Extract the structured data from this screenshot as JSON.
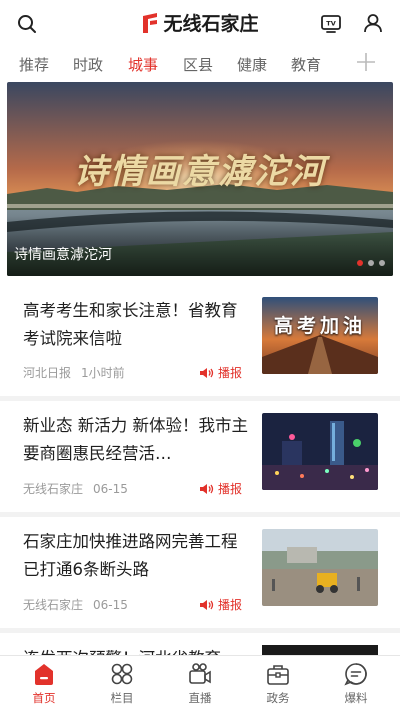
{
  "header": {
    "app_title": "无线石家庄",
    "brand_color": "#e2322b"
  },
  "tabs": [
    {
      "label": "推荐"
    },
    {
      "label": "时政"
    },
    {
      "label": "城事",
      "active": true
    },
    {
      "label": "区县"
    },
    {
      "label": "健康"
    },
    {
      "label": "教育"
    }
  ],
  "banner": {
    "overlay_title": "诗情画意滹沱河",
    "caption": "诗情画意滹沱河",
    "dot_count": 3,
    "active_dot": 1
  },
  "news": [
    {
      "title": "高考考生和家长注意！省教育考试院来信啦",
      "source": "河北日报",
      "time": "1小时前",
      "action": "播报",
      "thumb_text": "高考加油"
    },
    {
      "title": "新业态 新活力 新体验！我市主要商圈惠民经营活…",
      "source": "无线石家庄",
      "time": "06-15",
      "action": "播报"
    },
    {
      "title": "石家庄加快推进路网完善工程 已打通6条断头路",
      "source": "无线石家庄",
      "time": "06-15",
      "action": "播报"
    },
    {
      "title": "连发两次预警！河北省教育"
    }
  ],
  "bottom_nav": [
    {
      "label": "首页",
      "icon": "home-icon",
      "active": true
    },
    {
      "label": "栏目",
      "icon": "grid-icon"
    },
    {
      "label": "直播",
      "icon": "camera-icon"
    },
    {
      "label": "政务",
      "icon": "briefcase-icon"
    },
    {
      "label": "爆料",
      "icon": "chat-icon"
    }
  ]
}
